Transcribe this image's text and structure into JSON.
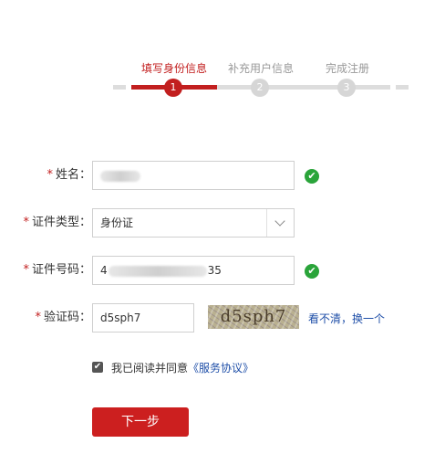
{
  "steps": [
    {
      "label": "填写身份信息",
      "number": "1",
      "active": true
    },
    {
      "label": "补充用户信息",
      "number": "2",
      "active": false
    },
    {
      "label": "完成注册",
      "number": "3",
      "active": false
    }
  ],
  "form": {
    "required_mark": "*",
    "name": {
      "label": "姓名："
    },
    "id_type": {
      "label": "证件类型：",
      "value": "身份证"
    },
    "id_number": {
      "label": "证件号码：",
      "prefix": "4",
      "suffix": "35"
    },
    "captcha": {
      "label": "验证码：",
      "value": "d5sph7",
      "image_text": "d5sph7",
      "refresh_link": "看不清，换一个"
    },
    "success_icon": "✔"
  },
  "agreement": {
    "checkbox_mark": "✔",
    "text": "我已阅读并同意",
    "link": "《服务协议》"
  },
  "next_button": "下一步",
  "colors": {
    "accent": "#c21f1f",
    "success": "#2aa43a",
    "link": "#1f4fa8"
  }
}
